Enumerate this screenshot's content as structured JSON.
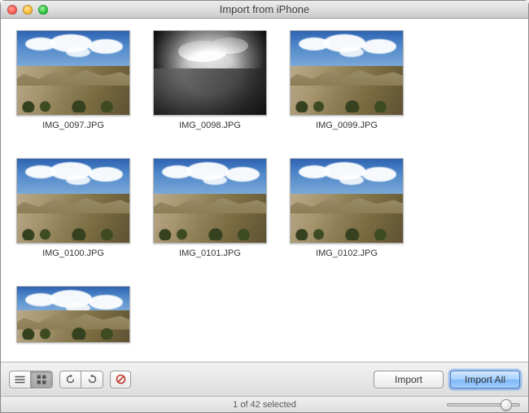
{
  "window": {
    "title": "Import from  iPhone"
  },
  "items": [
    {
      "filename": "IMG_0097.JPG",
      "style": "land",
      "partial": false
    },
    {
      "filename": "IMG_0098.JPG",
      "style": "bw",
      "partial": false
    },
    {
      "filename": "IMG_0099.JPG",
      "style": "land",
      "partial": false
    },
    {
      "filename": "IMG_0100.JPG",
      "style": "land",
      "partial": false
    },
    {
      "filename": "IMG_0101.JPG",
      "style": "land",
      "partial": false
    },
    {
      "filename": "IMG_0102.JPG",
      "style": "land",
      "partial": false
    },
    {
      "filename": "",
      "style": "land",
      "partial": true
    }
  ],
  "toolbar": {
    "view_list_icon": "list-view-icon",
    "view_grid_icon": "grid-view-icon",
    "rotate_ccw_icon": "rotate-ccw-icon",
    "rotate_cw_icon": "rotate-cw-icon",
    "reject_icon": "no-entry-icon",
    "import_label": "Import",
    "import_all_label": "Import All"
  },
  "status": {
    "text": "1 of 42 selected"
  },
  "slider": {
    "value": 0.88
  }
}
